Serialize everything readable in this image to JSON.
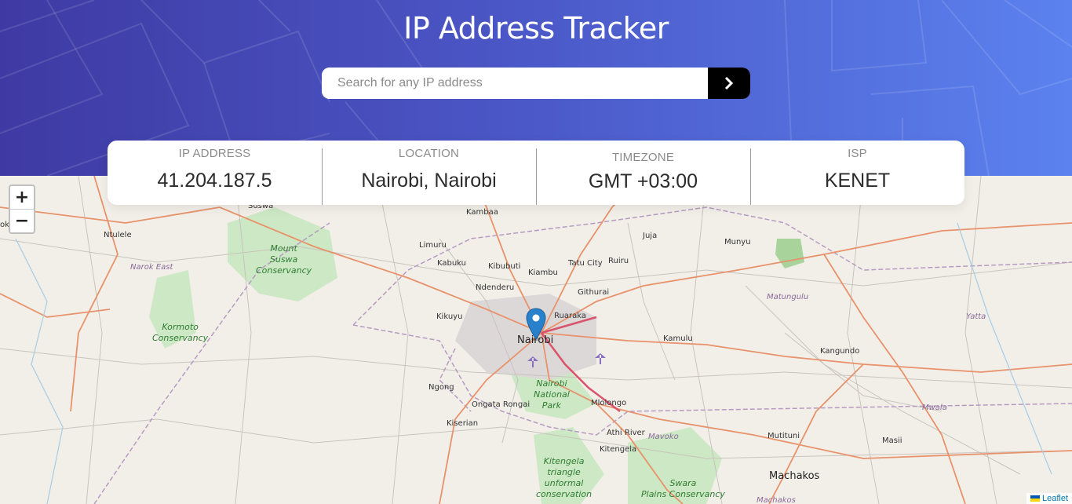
{
  "app": {
    "title": "IP Address Tracker"
  },
  "search": {
    "placeholder": "Search for any IP address",
    "value": "",
    "button_icon": "chevron-right-icon"
  },
  "info": {
    "ip": {
      "label": "IP Address",
      "value": "41.204.187.5"
    },
    "location": {
      "label": "Location",
      "value": "Nairobi, Nairobi"
    },
    "timezone": {
      "label": "Timezone",
      "value": "GMT +03:00"
    },
    "isp": {
      "label": "ISP",
      "value": "KENET"
    }
  },
  "map": {
    "zoom_in": "+",
    "zoom_out": "−",
    "attribution": "Leaflet",
    "labels": {
      "suswa": "Suswa",
      "ntulele": "Ntulele",
      "narok_east": "Narok East",
      "mount_suswa": "Mount",
      "mount_suswa2": "Suswa",
      "mount_suswa3": "Conservancy",
      "kormoto": "Kormoto",
      "kormoto2": "Conservancy",
      "kambaa": "Kambaa",
      "limuru": "Limuru",
      "kabuku": "Kabuku",
      "kibubuti": "Kibubuti",
      "kiambu": "Kiambu",
      "tatu_city": "Tatu City",
      "ruiru": "Ruiru",
      "juja": "Juja",
      "munyu": "Munyu",
      "ndenderu": "Ndenderu",
      "githurai": "Githurai",
      "kikuyu": "Kikuyu",
      "ruaraka": "Ruaraka",
      "nairobi": "Nairobi",
      "kamulu": "Kamulu",
      "matungulu": "Matungulu",
      "yatta": "Yatta",
      "kangundo": "Kangundo",
      "ngong": "Ngong",
      "nnp1": "Nairobi",
      "nnp2": "National",
      "nnp3": "Park",
      "ongata": "Ongata Rongai",
      "mlolongo": "Mlolongo",
      "kiserian": "Kiserian",
      "athi_river": "Athi River",
      "mavoko": "Mavoko",
      "kitengela": "Kitengela",
      "mwala": "Mwala",
      "mutituni": "Mutituni",
      "masii": "Masii",
      "machakos": "Machakos",
      "ktc1": "Kitengela",
      "ktc2": "triangle",
      "ktc3": "unformal",
      "ktc4": "conservation",
      "swara1": "Swara",
      "swara2": "Plains Conservancy",
      "ok": "ok",
      "machakos2": "Machakos"
    }
  },
  "colors": {
    "accent": "#000000",
    "header_start": "#3f3aa3",
    "header_end": "#5b82ef",
    "marker": "#2a81cb"
  }
}
